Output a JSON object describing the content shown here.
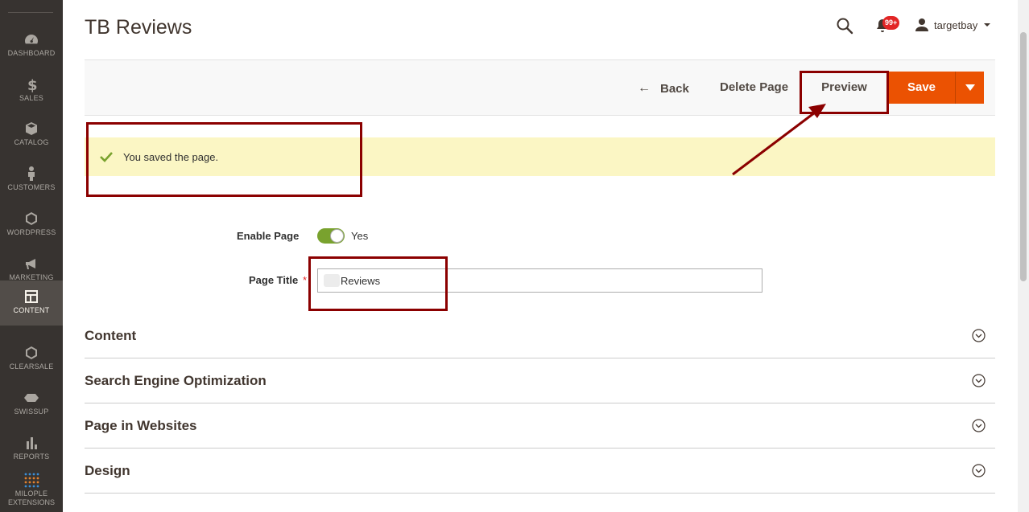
{
  "sidebar": {
    "items": [
      {
        "label": "DASHBOARD",
        "icon": "dashboard-icon"
      },
      {
        "label": "SALES",
        "icon": "dollar-icon"
      },
      {
        "label": "CATALOG",
        "icon": "box-icon"
      },
      {
        "label": "CUSTOMERS",
        "icon": "person-icon"
      },
      {
        "label": "WORDPRESS",
        "icon": "hexagon-icon"
      },
      {
        "label": "MARKETING",
        "icon": "megaphone-icon"
      },
      {
        "label": "CONTENT",
        "icon": "layout-icon"
      },
      {
        "label": "CLEARSALE",
        "icon": "hexagon-icon"
      },
      {
        "label": "SWISSUP",
        "icon": "swissup-icon"
      },
      {
        "label": "REPORTS",
        "icon": "bar-chart-icon"
      },
      {
        "label_line1": "MILOPLE",
        "label_line2": "EXTENSIONS",
        "icon": "grid-dots-icon"
      }
    ],
    "active": "CONTENT"
  },
  "header": {
    "title": "TB Reviews",
    "notifications_badge": "99+",
    "user": "targetbay"
  },
  "actions": {
    "back": "Back",
    "delete": "Delete Page",
    "preview": "Preview",
    "save": "Save"
  },
  "message": {
    "text": "You saved the page."
  },
  "form": {
    "enable_label": "Enable Page",
    "enable_value": "Yes",
    "title_label": "Page Title",
    "title_value": "Reviews"
  },
  "sections": [
    {
      "title": "Content"
    },
    {
      "title": "Search Engine Optimization"
    },
    {
      "title": "Page in Websites"
    },
    {
      "title": "Design"
    }
  ],
  "colors": {
    "sidebar_bg": "#373330",
    "accent_orange": "#eb5202",
    "annotation": "#8b0000",
    "toggle_on": "#79a22e",
    "message_bg": "#fbf6c4"
  }
}
